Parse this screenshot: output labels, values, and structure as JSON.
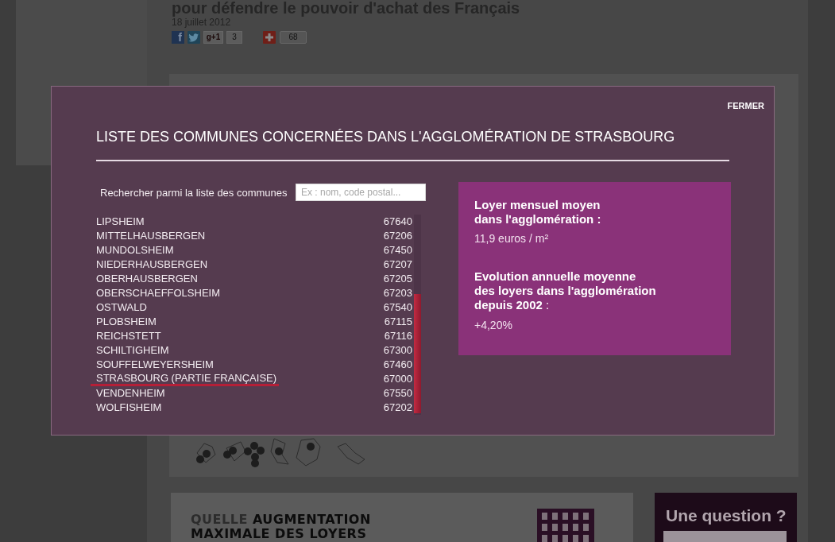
{
  "article": {
    "title": "pour défendre le pouvoir d'achat des Français",
    "date": "18 juillet 2012",
    "share_buttons": [
      {
        "kind": "facebook",
        "label": "f"
      },
      {
        "kind": "twitter"
      },
      {
        "kind": "gplus",
        "label": "g+1"
      },
      {
        "kind": "count",
        "label": "3"
      },
      {
        "kind": "add"
      },
      {
        "kind": "bubble",
        "label": "68"
      }
    ]
  },
  "modal": {
    "close": "FERMER",
    "title": "LISTE DES COMMUNES CONCERNÉES DANS L'AGGLOMÉRATION DE STRASBOURG",
    "search": {
      "label": "Rechercher parmi la liste des communes",
      "placeholder": "Ex : nom, code postal..."
    },
    "communes": [
      {
        "name": "LIPSHEIM",
        "code": "67640",
        "selected": false
      },
      {
        "name": "MITTELHAUSBERGEN",
        "code": "67206",
        "selected": false
      },
      {
        "name": "MUNDOLSHEIM",
        "code": "67450",
        "selected": false
      },
      {
        "name": "NIEDERHAUSBERGEN",
        "code": "67207",
        "selected": false
      },
      {
        "name": "OBERHAUSBERGEN",
        "code": "67205",
        "selected": false
      },
      {
        "name": "OBERSCHAEFFOLSHEIM",
        "code": "67203",
        "selected": false
      },
      {
        "name": "OSTWALD",
        "code": "67540",
        "selected": false
      },
      {
        "name": "PLOBSHEIM",
        "code": "67115",
        "selected": false
      },
      {
        "name": "REICHSTETT",
        "code": "67116",
        "selected": false
      },
      {
        "name": "SCHILTIGHEIM",
        "code": "67300",
        "selected": false
      },
      {
        "name": "SOUFFELWEYERSHEIM",
        "code": "67460",
        "selected": false
      },
      {
        "name": "STRASBOURG (PARTIE FRANÇAISE)",
        "code": "67000",
        "selected": true
      },
      {
        "name": "VENDENHEIM",
        "code": "67550",
        "selected": false
      },
      {
        "name": "WOLFISHEIM",
        "code": "67202",
        "selected": false
      }
    ],
    "stats": [
      {
        "label_lines": [
          "**Loyer mensuel moyen**",
          "**dans l'agglomération :**"
        ],
        "value": "11,9 euros / m²"
      },
      {
        "label_lines": [
          "**Evolution annuelle moyenne**",
          "**des loyers dans l'agglomération**",
          "**depuis 2002** :"
        ],
        "value": "+4,20%"
      }
    ]
  },
  "rent_increase": {
    "heading": "QUELLE **AUGMENTATION MAXIMALE DES LOYERS**"
  },
  "question_box": {
    "title": "Une question ?"
  }
}
